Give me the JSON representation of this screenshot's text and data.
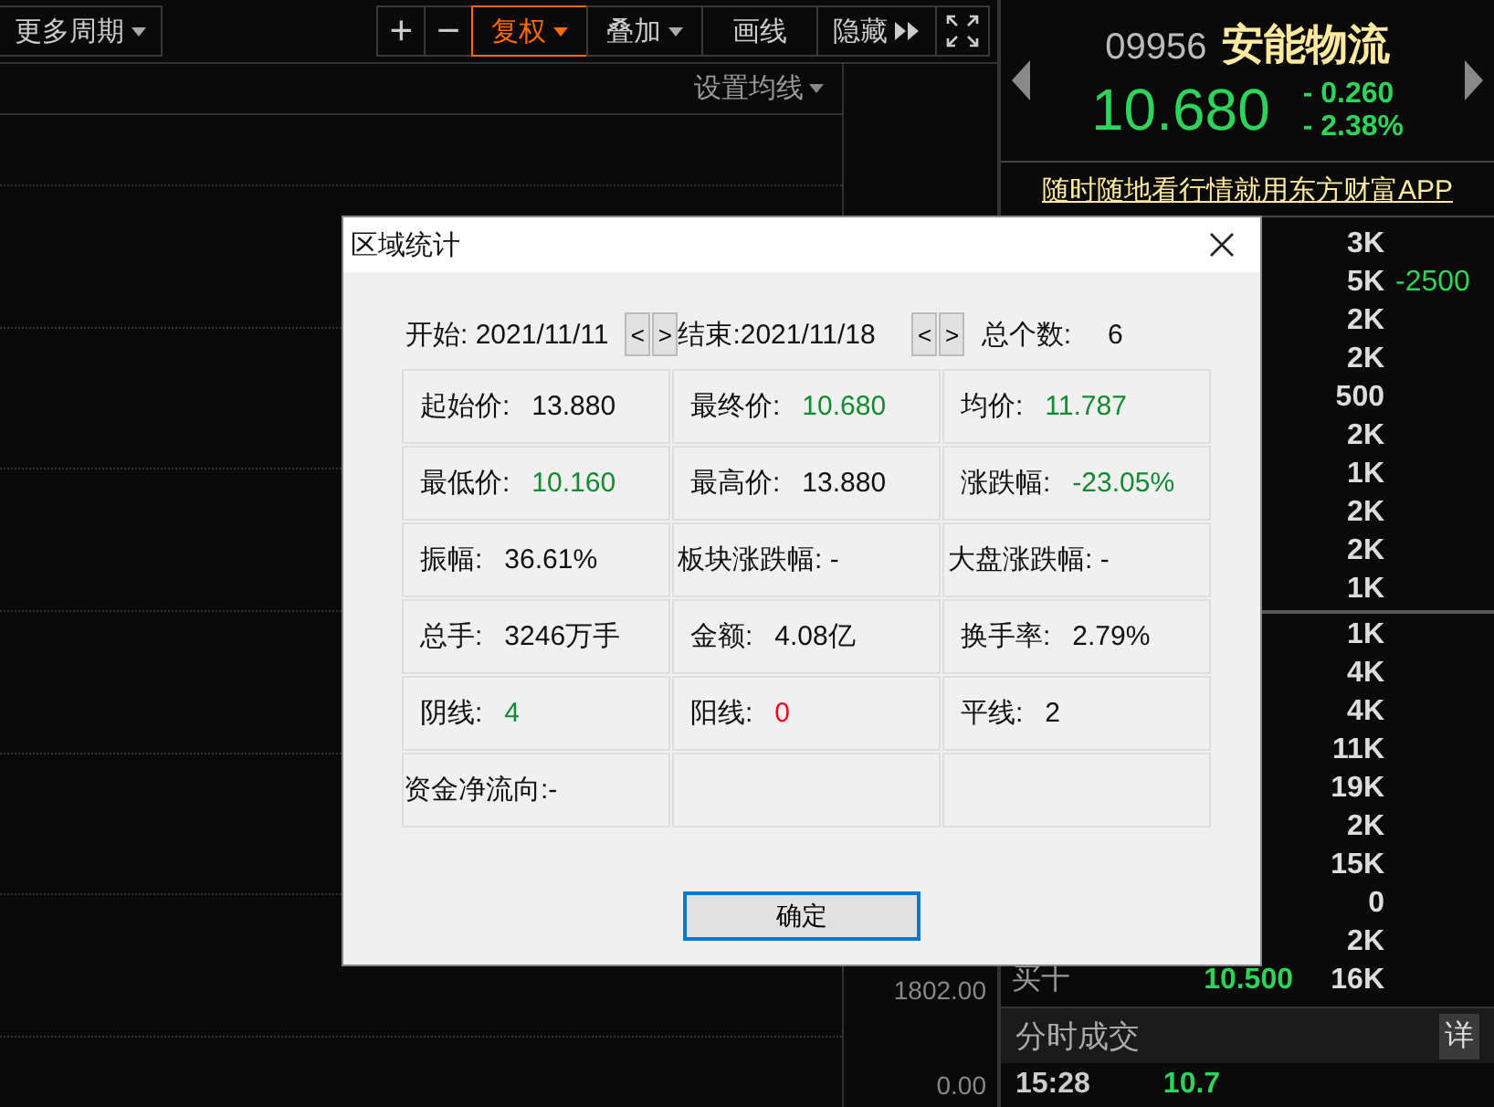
{
  "toolbar": {
    "period_menu": "更多周期",
    "buttons": [
      {
        "kind": "glyph",
        "label": "+",
        "selected": false
      },
      {
        "kind": "glyph",
        "label": "−",
        "selected": false
      },
      {
        "kind": "menu",
        "label": "复权",
        "selected": true
      },
      {
        "kind": "menu",
        "label": "叠加",
        "selected": false
      },
      {
        "kind": "plain",
        "label": "画线",
        "selected": false
      },
      {
        "kind": "expand",
        "label": "隐藏",
        "selected": false
      },
      {
        "kind": "fullscreen",
        "selected": false
      }
    ]
  },
  "chart": {
    "ma_menu": "设置均线",
    "axis_labels": [
      "1802.00",
      "0.00"
    ]
  },
  "quote": {
    "code": "09956",
    "name": "安能物流",
    "price": "10.680",
    "change": "- 0.260",
    "change_pct": "- 2.38%",
    "banner": "随时随地看行情就用东方财富APP"
  },
  "depth": {
    "sell": [
      {
        "volume": "3K"
      },
      {
        "volume": "5K",
        "delta": "-2500"
      },
      {
        "volume": "2K"
      },
      {
        "volume": "2K"
      },
      {
        "volume": "500"
      },
      {
        "volume": "2K"
      },
      {
        "volume": "1K"
      },
      {
        "volume": "2K"
      },
      {
        "volume": "2K"
      },
      {
        "volume": "1K"
      }
    ],
    "buy": [
      {
        "volume": "1K"
      },
      {
        "volume": "4K"
      },
      {
        "volume": "4K"
      },
      {
        "volume": "11K"
      },
      {
        "volume": "19K"
      },
      {
        "volume": "2K"
      },
      {
        "volume": "15K"
      },
      {
        "volume": "0"
      },
      {
        "volume": "2K"
      },
      {
        "label": "买十",
        "price": "10.500",
        "volume": "16K"
      }
    ]
  },
  "trades": {
    "title": "分时成交",
    "detail": "详",
    "rows": [
      {
        "time": "15:28",
        "price": "10.7"
      }
    ]
  },
  "dialog": {
    "title": "区域统计",
    "start_label": "开始:",
    "start": "2021/11/11",
    "end_label": "结束:",
    "end": "2021/11/18",
    "prev": "<",
    "next": ">",
    "count_label": "总个数:",
    "count": "6",
    "rows": [
      [
        {
          "label": "起始价:",
          "value": "13.880",
          "color": "#111111"
        },
        {
          "label": "最终价:",
          "value": "10.680",
          "color": "#128a2d"
        },
        {
          "label": "均价:",
          "value": "11.787",
          "color": "#128a2d"
        }
      ],
      [
        {
          "label": "最低价:",
          "value": "10.160",
          "color": "#128a2d"
        },
        {
          "label": "最高价:",
          "value": "13.880",
          "color": "#111111"
        },
        {
          "label": "涨跌幅:",
          "value": "-23.05%",
          "color": "#128a2d"
        }
      ],
      [
        {
          "label": "振幅:",
          "value": "36.61%",
          "color": "#111111"
        },
        {
          "label": "板块涨跌幅: -",
          "kind": "text"
        },
        {
          "label": "大盘涨跌幅: -",
          "kind": "text"
        }
      ],
      [
        {
          "label": "总手:",
          "value": "3246万手",
          "color": "#111111"
        },
        {
          "label": "金额:",
          "value": "4.08亿",
          "color": "#111111"
        },
        {
          "label": "换手率:",
          "value": "2.79%",
          "color": "#111111"
        }
      ],
      [
        {
          "label": "阴线:",
          "value": "4",
          "color": "#128a2d"
        },
        {
          "label": "阳线:",
          "value": "0",
          "color": "#e8001c"
        },
        {
          "label": "平线:",
          "value": "2",
          "color": "#111111"
        }
      ],
      [
        {
          "label": "资金净流向:-",
          "kind": "text"
        },
        {
          "kind": "empty"
        },
        {
          "kind": "empty"
        }
      ]
    ],
    "ok": "确定"
  }
}
